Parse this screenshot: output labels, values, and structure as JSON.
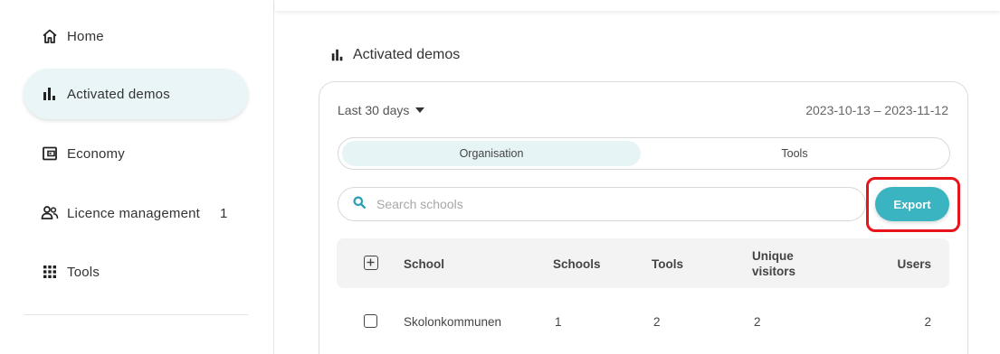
{
  "sidebar": {
    "items": [
      {
        "label": "Home",
        "icon": "home-icon"
      },
      {
        "label": "Activated demos",
        "icon": "bar-chart-icon",
        "active": true
      },
      {
        "label": "Economy",
        "icon": "wallet-icon"
      },
      {
        "label": "Licence management",
        "icon": "users-icon",
        "badge": "1"
      },
      {
        "label": "Tools",
        "icon": "grid-icon"
      }
    ]
  },
  "main": {
    "title": "Activated demos",
    "period_label": "Last 30 days",
    "date_range": "2023-10-13 – 2023-11-12",
    "tabs": [
      {
        "label": "Organisation",
        "selected": true
      },
      {
        "label": "Tools",
        "selected": false
      }
    ],
    "search": {
      "placeholder": "Search schools"
    },
    "export_label": "Export",
    "table": {
      "columns": [
        "School",
        "Schools",
        "Tools",
        "Unique visitors",
        "Users"
      ],
      "rows": [
        {
          "school": "Skolonkommunen",
          "schools": "1",
          "tools": "2",
          "unique_visitors": "2",
          "users": "2"
        }
      ]
    }
  },
  "colors": {
    "accent": "#3bb4c1",
    "active_bg": "#e9f5f7",
    "highlight": "#e8141c"
  }
}
